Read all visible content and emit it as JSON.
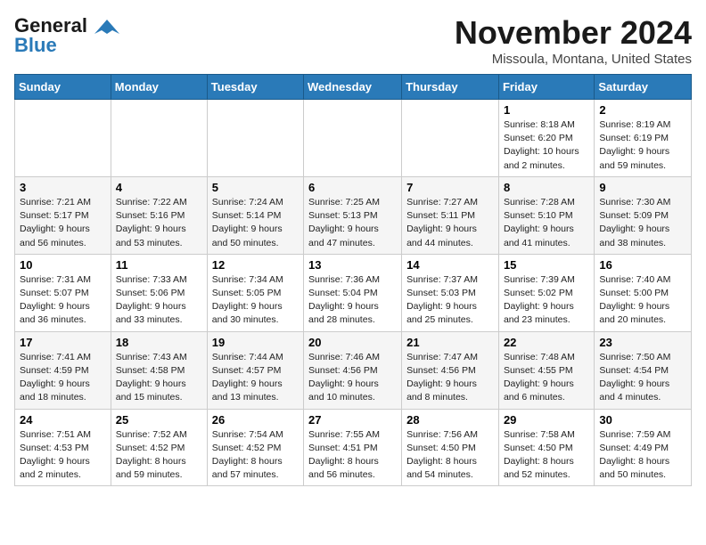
{
  "logo": {
    "line1": "General",
    "line2": "Blue"
  },
  "title": "November 2024",
  "subtitle": "Missoula, Montana, United States",
  "weekdays": [
    "Sunday",
    "Monday",
    "Tuesday",
    "Wednesday",
    "Thursday",
    "Friday",
    "Saturday"
  ],
  "weeks": [
    [
      {
        "day": "",
        "info": ""
      },
      {
        "day": "",
        "info": ""
      },
      {
        "day": "",
        "info": ""
      },
      {
        "day": "",
        "info": ""
      },
      {
        "day": "",
        "info": ""
      },
      {
        "day": "1",
        "info": "Sunrise: 8:18 AM\nSunset: 6:20 PM\nDaylight: 10 hours\nand 2 minutes."
      },
      {
        "day": "2",
        "info": "Sunrise: 8:19 AM\nSunset: 6:19 PM\nDaylight: 9 hours\nand 59 minutes."
      }
    ],
    [
      {
        "day": "3",
        "info": "Sunrise: 7:21 AM\nSunset: 5:17 PM\nDaylight: 9 hours\nand 56 minutes."
      },
      {
        "day": "4",
        "info": "Sunrise: 7:22 AM\nSunset: 5:16 PM\nDaylight: 9 hours\nand 53 minutes."
      },
      {
        "day": "5",
        "info": "Sunrise: 7:24 AM\nSunset: 5:14 PM\nDaylight: 9 hours\nand 50 minutes."
      },
      {
        "day": "6",
        "info": "Sunrise: 7:25 AM\nSunset: 5:13 PM\nDaylight: 9 hours\nand 47 minutes."
      },
      {
        "day": "7",
        "info": "Sunrise: 7:27 AM\nSunset: 5:11 PM\nDaylight: 9 hours\nand 44 minutes."
      },
      {
        "day": "8",
        "info": "Sunrise: 7:28 AM\nSunset: 5:10 PM\nDaylight: 9 hours\nand 41 minutes."
      },
      {
        "day": "9",
        "info": "Sunrise: 7:30 AM\nSunset: 5:09 PM\nDaylight: 9 hours\nand 38 minutes."
      }
    ],
    [
      {
        "day": "10",
        "info": "Sunrise: 7:31 AM\nSunset: 5:07 PM\nDaylight: 9 hours\nand 36 minutes."
      },
      {
        "day": "11",
        "info": "Sunrise: 7:33 AM\nSunset: 5:06 PM\nDaylight: 9 hours\nand 33 minutes."
      },
      {
        "day": "12",
        "info": "Sunrise: 7:34 AM\nSunset: 5:05 PM\nDaylight: 9 hours\nand 30 minutes."
      },
      {
        "day": "13",
        "info": "Sunrise: 7:36 AM\nSunset: 5:04 PM\nDaylight: 9 hours\nand 28 minutes."
      },
      {
        "day": "14",
        "info": "Sunrise: 7:37 AM\nSunset: 5:03 PM\nDaylight: 9 hours\nand 25 minutes."
      },
      {
        "day": "15",
        "info": "Sunrise: 7:39 AM\nSunset: 5:02 PM\nDaylight: 9 hours\nand 23 minutes."
      },
      {
        "day": "16",
        "info": "Sunrise: 7:40 AM\nSunset: 5:00 PM\nDaylight: 9 hours\nand 20 minutes."
      }
    ],
    [
      {
        "day": "17",
        "info": "Sunrise: 7:41 AM\nSunset: 4:59 PM\nDaylight: 9 hours\nand 18 minutes."
      },
      {
        "day": "18",
        "info": "Sunrise: 7:43 AM\nSunset: 4:58 PM\nDaylight: 9 hours\nand 15 minutes."
      },
      {
        "day": "19",
        "info": "Sunrise: 7:44 AM\nSunset: 4:57 PM\nDaylight: 9 hours\nand 13 minutes."
      },
      {
        "day": "20",
        "info": "Sunrise: 7:46 AM\nSunset: 4:56 PM\nDaylight: 9 hours\nand 10 minutes."
      },
      {
        "day": "21",
        "info": "Sunrise: 7:47 AM\nSunset: 4:56 PM\nDaylight: 9 hours\nand 8 minutes."
      },
      {
        "day": "22",
        "info": "Sunrise: 7:48 AM\nSunset: 4:55 PM\nDaylight: 9 hours\nand 6 minutes."
      },
      {
        "day": "23",
        "info": "Sunrise: 7:50 AM\nSunset: 4:54 PM\nDaylight: 9 hours\nand 4 minutes."
      }
    ],
    [
      {
        "day": "24",
        "info": "Sunrise: 7:51 AM\nSunset: 4:53 PM\nDaylight: 9 hours\nand 2 minutes."
      },
      {
        "day": "25",
        "info": "Sunrise: 7:52 AM\nSunset: 4:52 PM\nDaylight: 8 hours\nand 59 minutes."
      },
      {
        "day": "26",
        "info": "Sunrise: 7:54 AM\nSunset: 4:52 PM\nDaylight: 8 hours\nand 57 minutes."
      },
      {
        "day": "27",
        "info": "Sunrise: 7:55 AM\nSunset: 4:51 PM\nDaylight: 8 hours\nand 56 minutes."
      },
      {
        "day": "28",
        "info": "Sunrise: 7:56 AM\nSunset: 4:50 PM\nDaylight: 8 hours\nand 54 minutes."
      },
      {
        "day": "29",
        "info": "Sunrise: 7:58 AM\nSunset: 4:50 PM\nDaylight: 8 hours\nand 52 minutes."
      },
      {
        "day": "30",
        "info": "Sunrise: 7:59 AM\nSunset: 4:49 PM\nDaylight: 8 hours\nand 50 minutes."
      }
    ]
  ]
}
